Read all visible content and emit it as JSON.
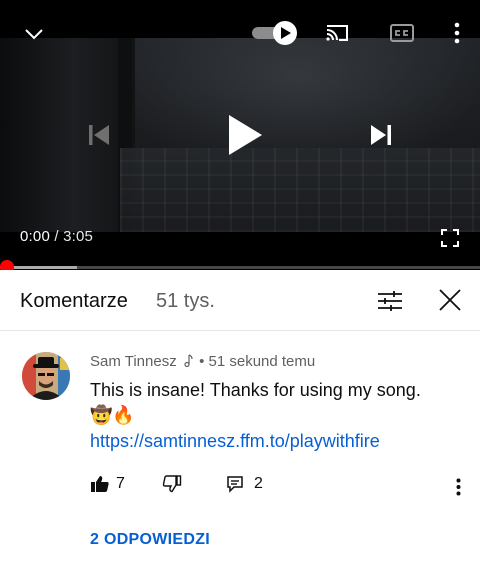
{
  "player": {
    "current_time": "0:00",
    "duration": "/ 3:05",
    "progress_fraction": 0.0,
    "buffer_fraction": 0.16,
    "icons": {
      "collapse": "chevron-down-icon",
      "autoplay": "autoplay-toggle-icon",
      "cast": "cast-icon",
      "captions": "captions-icon",
      "menu": "more-vert-icon",
      "prev": "skip-previous-icon",
      "play": "play-icon",
      "next": "skip-next-icon",
      "fullscreen": "fullscreen-icon"
    },
    "colors": {
      "progress_knob": "#ff0000"
    }
  },
  "comments_panel": {
    "title": "Komentarze",
    "count": "51 tys."
  },
  "comment": {
    "author": "Sam Tinnesz",
    "time": "51 sekund temu",
    "text": "This is insane! Thanks for using my song.",
    "emojis": "🤠🔥",
    "link": "https://samtinnesz.ffm.to/playwithfire",
    "likes": "7",
    "reply_count": "2",
    "replies_label": "2 ODPOWIEDZI",
    "colors": {
      "link": "#065fd4"
    }
  }
}
